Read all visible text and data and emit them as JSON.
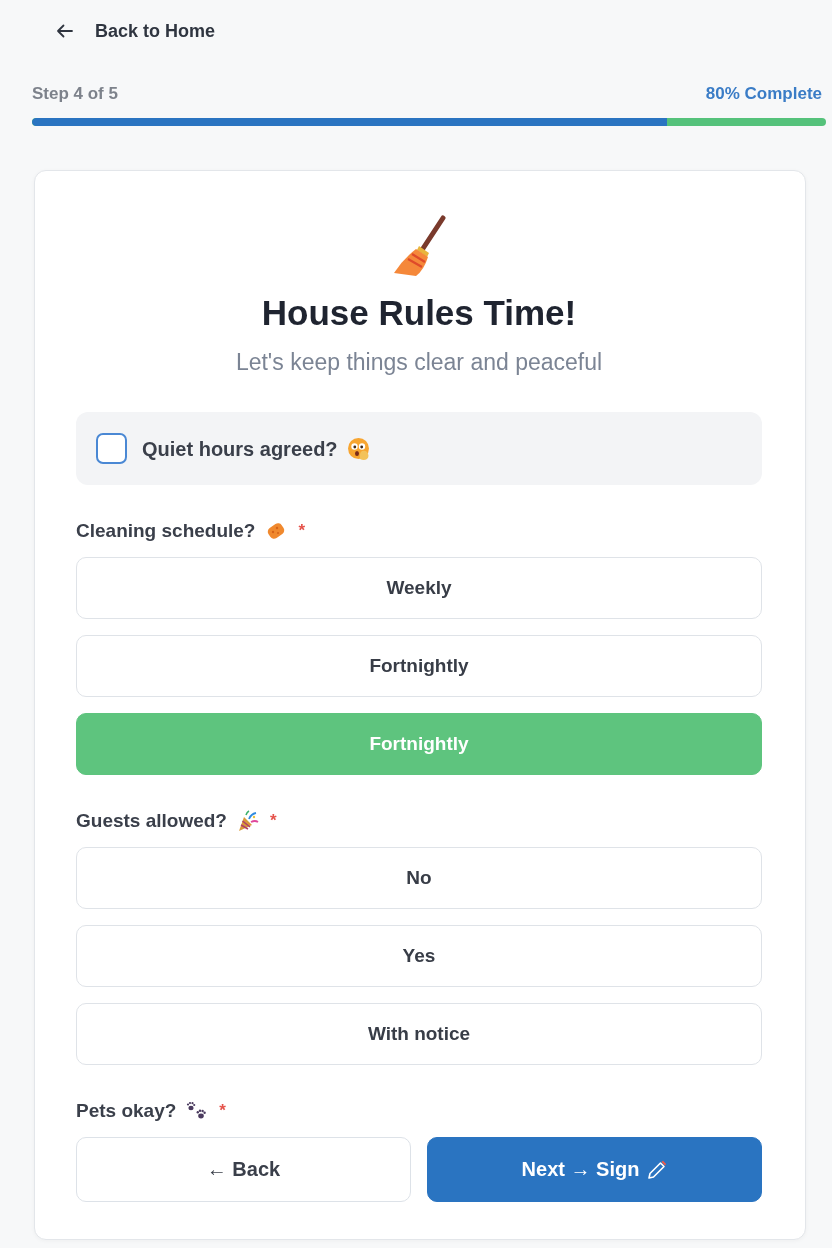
{
  "back_link": {
    "label": "Back to Home"
  },
  "progress": {
    "step": "Step 4 of 5",
    "percent": "80% Complete",
    "level": 0.8
  },
  "card": {
    "title": "House Rules Time!",
    "subtitle": "Let's keep things clear and peaceful"
  },
  "quiet_hours": {
    "label": "Quiet hours agreed?",
    "checked": false
  },
  "questions": [
    {
      "label": "Cleaning schedule?",
      "required_mark": "*",
      "options": [
        {
          "label": "Weekly",
          "selected": false
        },
        {
          "label": "Fortnightly",
          "selected": false
        },
        {
          "label": "Fortnightly",
          "selected": true
        }
      ]
    },
    {
      "label": "Guests allowed?",
      "required_mark": "*",
      "options": [
        {
          "label": "No",
          "selected": false
        },
        {
          "label": "Yes",
          "selected": false
        },
        {
          "label": "With notice",
          "selected": false
        }
      ]
    },
    {
      "label": "Pets okay?",
      "required_mark": "*"
    }
  ],
  "buttons": [
    {
      "label": "← Back",
      "kind": "secondary"
    },
    {
      "label": "Next → Sign",
      "kind": "primary"
    }
  ]
}
